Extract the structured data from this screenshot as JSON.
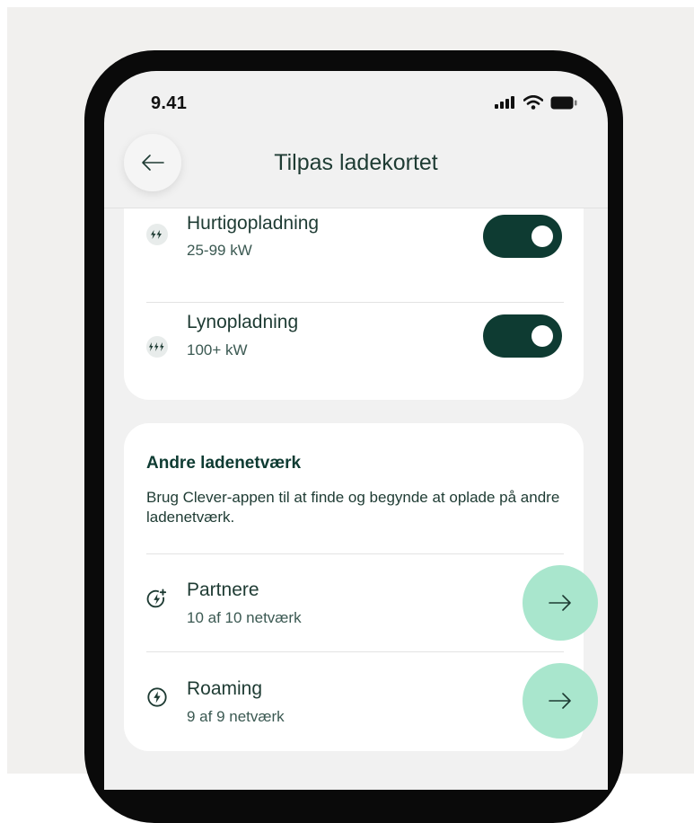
{
  "status_bar": {
    "time": "9.41",
    "icons": [
      "signal-icon",
      "wifi-icon",
      "battery-icon"
    ]
  },
  "header": {
    "title": "Tilpas ladekortet",
    "back_icon": "arrow-left-icon"
  },
  "charging_speeds": [
    {
      "title": "Hurtigopladning",
      "subtitle": "25-99 kW",
      "icon": "double-bolt-icon",
      "enabled": true
    },
    {
      "title": "Lynopladning",
      "subtitle": "100+ kW",
      "icon": "triple-bolt-icon",
      "enabled": true
    }
  ],
  "other_networks": {
    "title": "Andre ladenetværk",
    "description": "Brug Clever-appen til at finde og begynde at oplade på andre ladenetværk.",
    "items": [
      {
        "title": "Partnere",
        "subtitle": "10 af 10 netværk",
        "icon": "bolt-plus-circle-icon",
        "action_icon": "arrow-right-icon"
      },
      {
        "title": "Roaming",
        "subtitle": "9 af 9 netværk",
        "icon": "bolt-circle-icon",
        "action_icon": "arrow-right-icon"
      }
    ]
  },
  "colors": {
    "toggle_on": "#0e3b32",
    "arrow_button": "#a9e6cd",
    "text": "#1e3b33",
    "screen_bg": "#f1f1f1"
  }
}
